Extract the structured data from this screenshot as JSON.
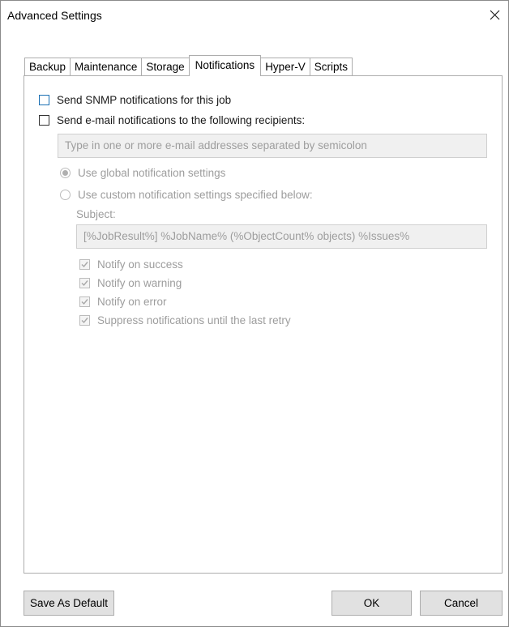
{
  "window": {
    "title": "Advanced Settings"
  },
  "tabs": [
    {
      "label": "Backup",
      "active": false
    },
    {
      "label": "Maintenance",
      "active": false
    },
    {
      "label": "Storage",
      "active": false
    },
    {
      "label": "Notifications",
      "active": true
    },
    {
      "label": "Hyper-V",
      "active": false
    },
    {
      "label": "Scripts",
      "active": false
    }
  ],
  "notifications": {
    "snmp": {
      "label": "Send SNMP notifications for this job",
      "checked": false
    },
    "email": {
      "label": "Send e-mail notifications to the following recipients:",
      "checked": false
    },
    "recipients": {
      "placeholder": "Type in one or more e-mail addresses separated by semicolon",
      "value": ""
    },
    "global_option": {
      "label": "Use global notification settings",
      "selected": true,
      "enabled": false
    },
    "custom_option": {
      "label": "Use custom notification settings specified below:",
      "selected": false,
      "enabled": false
    },
    "subject": {
      "label": "Subject:",
      "value": "[%JobResult%] %JobName% (%ObjectCount% objects) %Issues%"
    },
    "notify_success": {
      "label": "Notify on success",
      "checked": true,
      "enabled": false
    },
    "notify_warning": {
      "label": "Notify on warning",
      "checked": true,
      "enabled": false
    },
    "notify_error": {
      "label": "Notify on error",
      "checked": true,
      "enabled": false
    },
    "suppress": {
      "label": "Suppress notifications until the last retry",
      "checked": true,
      "enabled": false
    }
  },
  "buttons": {
    "save_default": "Save As Default",
    "ok": "OK",
    "cancel": "Cancel"
  },
  "colors": {
    "focus_border": "#1a6fb3",
    "disabled_text": "#9d9d9d",
    "button_bg": "#e1e1e1"
  }
}
